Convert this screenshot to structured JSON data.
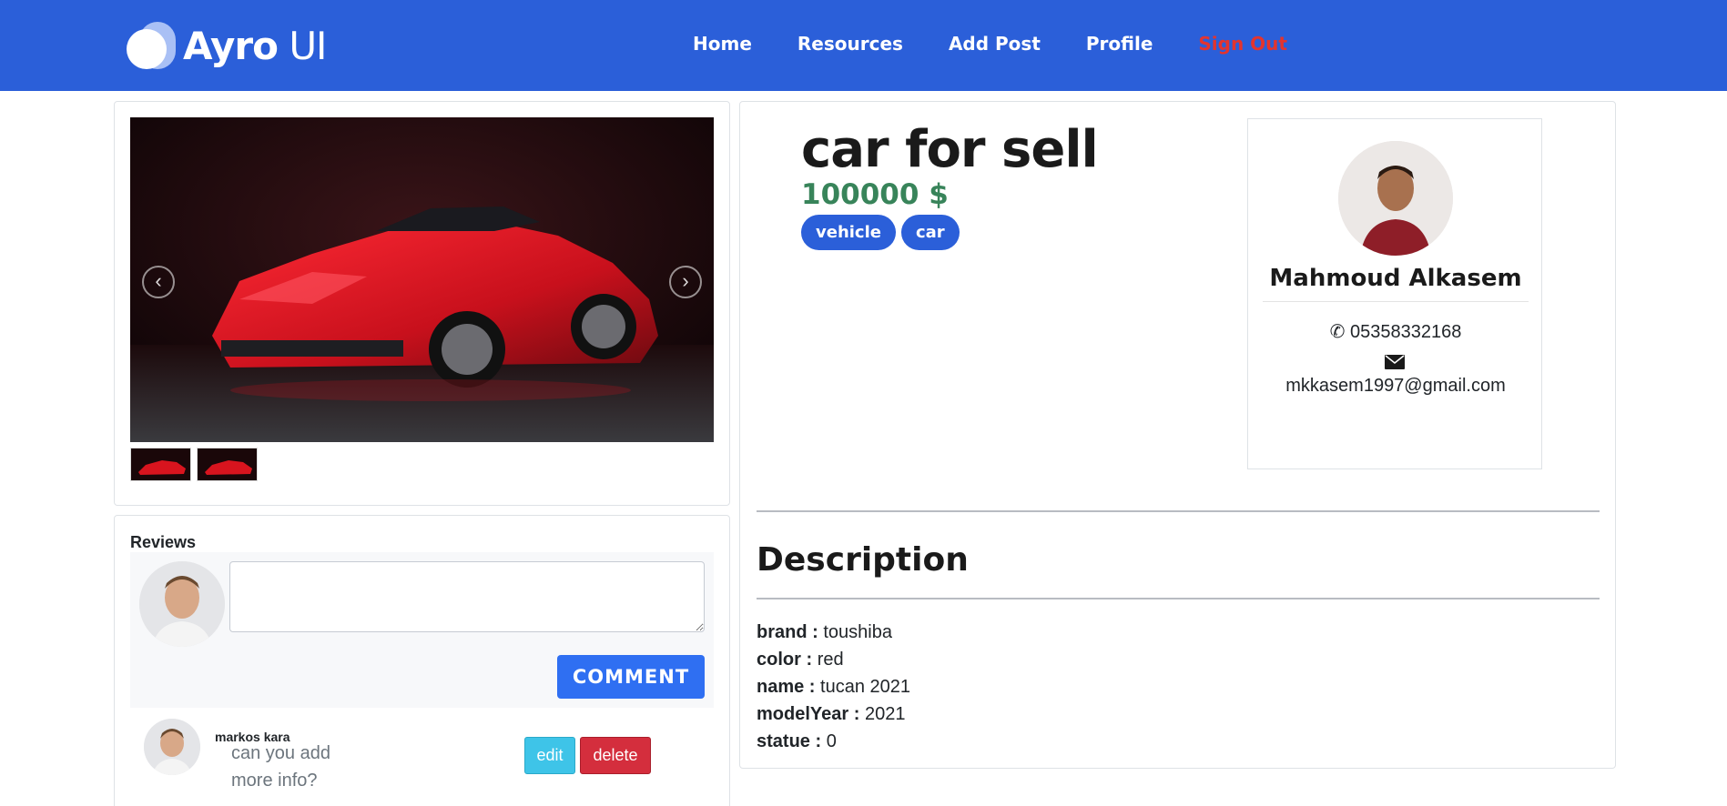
{
  "navbar": {
    "brand_bold": "Ayro",
    "brand_light": "UI",
    "links": [
      {
        "label": "Home"
      },
      {
        "label": "Resources"
      },
      {
        "label": "Add Post"
      },
      {
        "label": "Profile"
      },
      {
        "label": "Sign Out"
      }
    ]
  },
  "gallery": {
    "prev_icon": "chevron-left-icon",
    "next_icon": "chevron-right-icon",
    "thumbnail_count": 2
  },
  "reviews": {
    "title": "Reviews",
    "comment_input_value": "",
    "comment_button": "COMMENT",
    "items": [
      {
        "author": "markos kara",
        "text": "can you add more info?",
        "edit_label": "edit",
        "delete_label": "delete"
      }
    ]
  },
  "post": {
    "title": "car for sell",
    "price": "100000 $",
    "tags": [
      "vehicle",
      "car"
    ]
  },
  "seller": {
    "name": "Mahmoud Alkasem",
    "phone": "05358332168",
    "email": "mkkasem1997@gmail.com"
  },
  "description": {
    "title": "Description",
    "attributes": [
      {
        "key": "brand :",
        "value": "toushiba"
      },
      {
        "key": "color :",
        "value": "red"
      },
      {
        "key": "name :",
        "value": "tucan 2021"
      },
      {
        "key": "modelYear :",
        "value": "2021"
      },
      {
        "key": "statue :",
        "value": "0"
      }
    ]
  },
  "colors": {
    "navbar": "#2b5fd9",
    "signout": "#e3342f",
    "price": "#38845a",
    "primary_button": "#2f6ff2",
    "edit_button": "#3ec4e8",
    "delete_button": "#d42e3d"
  }
}
